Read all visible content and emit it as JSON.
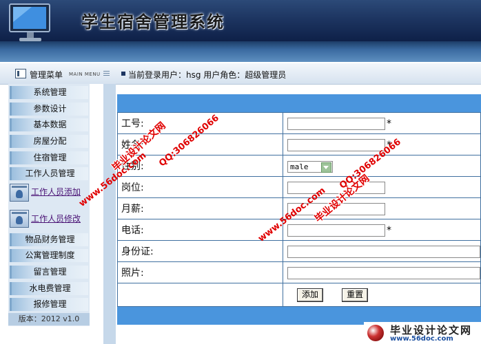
{
  "header": {
    "title": "学生宿舍管理系统"
  },
  "infobar": {
    "menu_title": "管理菜单",
    "menu_title_en": "MAIN MENU",
    "login_info": "当前登录用户：hsg  用户角色：超级管理员"
  },
  "sidebar": {
    "items_top": [
      "系统管理",
      "参数设计",
      "基本数据",
      "房屋分配",
      "住宿管理",
      "工作人员管理"
    ],
    "icon_items": [
      "工作人员添加",
      "工作人员修改"
    ],
    "items_bottom": [
      "物品财务管理",
      "公寓管理制度",
      "留言管理",
      "水电费管理",
      "报修管理"
    ],
    "version": "版本：2012 v1.0"
  },
  "form": {
    "fields": [
      {
        "label": "工号:",
        "value": "",
        "required": "*"
      },
      {
        "label": "姓名:",
        "value": "",
        "required": "*"
      },
      {
        "label": "性别:",
        "value": "male",
        "required": ""
      },
      {
        "label": "岗位:",
        "value": "",
        "required": ""
      },
      {
        "label": "月薪:",
        "value": "",
        "required": ""
      },
      {
        "label": "电话:",
        "value": "",
        "required": "*"
      },
      {
        "label": "身份证:",
        "value": "",
        "required": ""
      },
      {
        "label": "照片:",
        "value": "",
        "required": ""
      }
    ],
    "add_button": "添加",
    "reset_button": "重置"
  },
  "watermarks": {
    "cn": "毕业设计论文网",
    "url": "www.56doc.com",
    "qq": "QQ:306826066"
  },
  "brand": {
    "cn": "毕业设计论文网",
    "url": "www.56doc.com"
  },
  "colors": {
    "header_dark": "#0e2048",
    "form_bar": "#4a95dd",
    "sidebar_bg": "#dde8f3",
    "watermark": "#e00000"
  }
}
